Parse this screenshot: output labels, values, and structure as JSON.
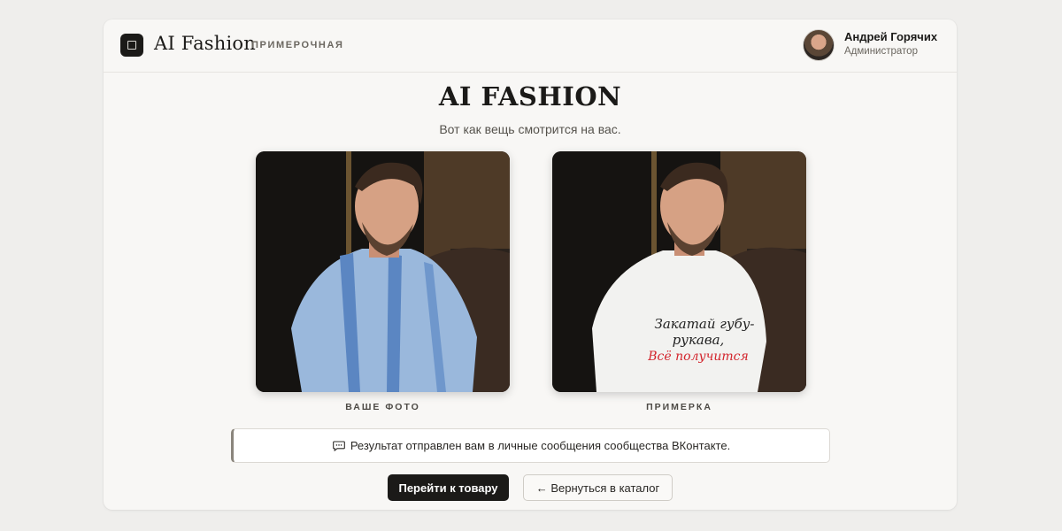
{
  "header": {
    "brand": "AI Fashion",
    "section": "ПРИМЕРОЧНАЯ",
    "logo_icon": "square-logo-icon",
    "user": {
      "name": "Андрей Горячих",
      "role": "Администратор",
      "avatar_icon": "user-avatar"
    }
  },
  "main": {
    "title": "AI FASHION",
    "subtitle": "Вот как вещь смотрится на вас.",
    "photos": [
      {
        "caption": "ВАШЕ ФОТО",
        "shirt": "blue-striped-shirt"
      },
      {
        "caption": "ПРИМЕРКА",
        "shirt": "white-print-tshirt",
        "print_line1": "Закатай губу-",
        "print_line2": "рукава,",
        "print_line3": "Всё получится"
      }
    ],
    "notice": {
      "icon": "chat-bubble-icon",
      "text": "Результат отправлен вам в личные сообщения сообщества ВКонтакте."
    },
    "actions": {
      "primary": "Перейти к товару",
      "secondary": "← Вернуться в каталог"
    }
  },
  "colors": {
    "background": "#efeeec",
    "card": "#f8f7f5",
    "primary_button": "#1b1a18",
    "accent_text": "#1b1a18"
  }
}
